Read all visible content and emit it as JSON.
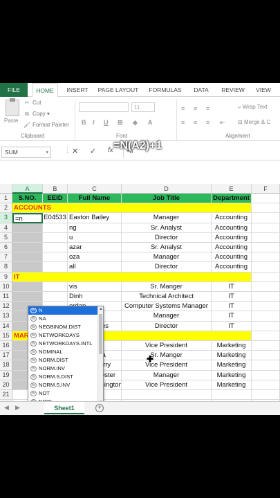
{
  "ribbon": {
    "tabs": [
      "FILE",
      "HOME",
      "INSERT",
      "PAGE LAYOUT",
      "FORMULAS",
      "DATA",
      "REVIEW",
      "VIEW"
    ],
    "paste_label": "Paste",
    "cut_label": "Cut",
    "copy_label": "Copy",
    "format_painter_label": "Format Painter",
    "clipboard_group": "Clipboard",
    "font_group": "Font",
    "font_size": "11",
    "wrap_text_label": "Wrap Text",
    "merge_label": "Merge & C",
    "alignment_group": "Alignment"
  },
  "formula_bar": {
    "name_box": "SUM",
    "cancel_glyph": "✕",
    "enter_glyph": "✓",
    "fx_glyph": "fx",
    "value": "=n",
    "overlay": "=N(A2)+1"
  },
  "columns": [
    "A",
    "B",
    "C",
    "D",
    "E",
    "F"
  ],
  "rows": [
    "1",
    "2",
    "3",
    "4",
    "5",
    "6",
    "7",
    "8",
    "9",
    "10",
    "11",
    "12",
    "13",
    "14",
    "15",
    "16",
    "17",
    "18",
    "19",
    "20",
    "21",
    "22"
  ],
  "header_row": [
    "S.NO.",
    "EEID",
    "Full Name",
    "Job Title",
    "Department"
  ],
  "sections": {
    "accounts": "ACCOUNTS",
    "it": "IT",
    "marketing": "MARKETING"
  },
  "active_cell_text": "=n",
  "accounts_rows": [
    [
      "E04533",
      "Easton Bailey",
      "Manager",
      "Accounting"
    ],
    [
      "",
      "ng",
      "Sr. Analyst",
      "Accounting"
    ],
    [
      "",
      "u",
      "Director",
      "Accounting"
    ],
    [
      "",
      "azar",
      "Sr. Analyst",
      "Accounting"
    ],
    [
      "",
      "oza",
      "Manager",
      "Accounting"
    ],
    [
      "",
      "all",
      "Director",
      "Accounting"
    ]
  ],
  "it_rows": [
    [
      "",
      "vis",
      "Sr. Manger",
      "IT"
    ],
    [
      "",
      "Dinh",
      "Technical Architect",
      "IT"
    ],
    [
      "",
      "erdan",
      "Computer Systems Manager",
      "IT"
    ],
    [
      "",
      "nes",
      "Manager",
      "IT"
    ],
    [
      "E04116",
      "David Barnes",
      "Director",
      "IT"
    ]
  ],
  "marketing_rows": [
    [
      "E00549",
      "Isabella Xi",
      "Vice President",
      "Marketing"
    ],
    [
      "E00884",
      "Camila Silva",
      "Sr. Manger",
      "Marketing"
    ],
    [
      "E01628",
      "Jackson Perry",
      "Vice President",
      "Marketing"
    ],
    [
      "E03749",
      "Kennedy Foster",
      "Manager",
      "Marketing"
    ],
    [
      "E00586",
      "Sadie Washington",
      "Vice President",
      "Marketing"
    ]
  ],
  "autocomplete": {
    "icon_glyph": "fx",
    "items": [
      "N",
      "NA",
      "NEGBINOM.DIST",
      "NETWORKDAYS",
      "NETWORKDAYS.INTL",
      "NOMINAL",
      "NORM.DIST",
      "NORM.INV",
      "NORM.S.DIST",
      "NORM.S.INV",
      "NOT",
      "NOW"
    ],
    "highlighted_index": 0
  },
  "sheet_tabs": {
    "active": "Sheet1",
    "add_glyph": "+"
  }
}
